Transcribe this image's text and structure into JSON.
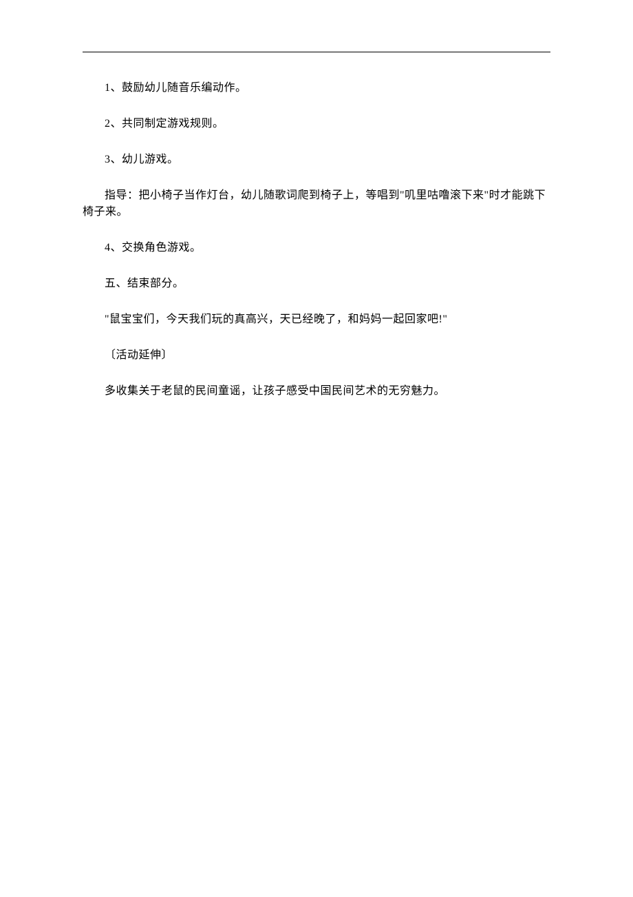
{
  "paragraphs": {
    "p1": "1、鼓励幼儿随音乐编动作。",
    "p2": "2、共同制定游戏规则。",
    "p3": "3、幼儿游戏。",
    "p4": "指导：把小椅子当作灯台，幼儿随歌词爬到椅子上，等唱到\"叽里咕噜滚下来\"时才能跳下椅子来。",
    "p5": "4、交换角色游戏。",
    "p6": "五、结束部分。",
    "p7": "\"鼠宝宝们，今天我们玩的真高兴，天已经晚了，和妈妈一起回家吧!\"",
    "p8": "〔活动延伸〕",
    "p9": "多收集关于老鼠的民间童谣，让孩子感受中国民间艺术的无穷魅力。"
  }
}
